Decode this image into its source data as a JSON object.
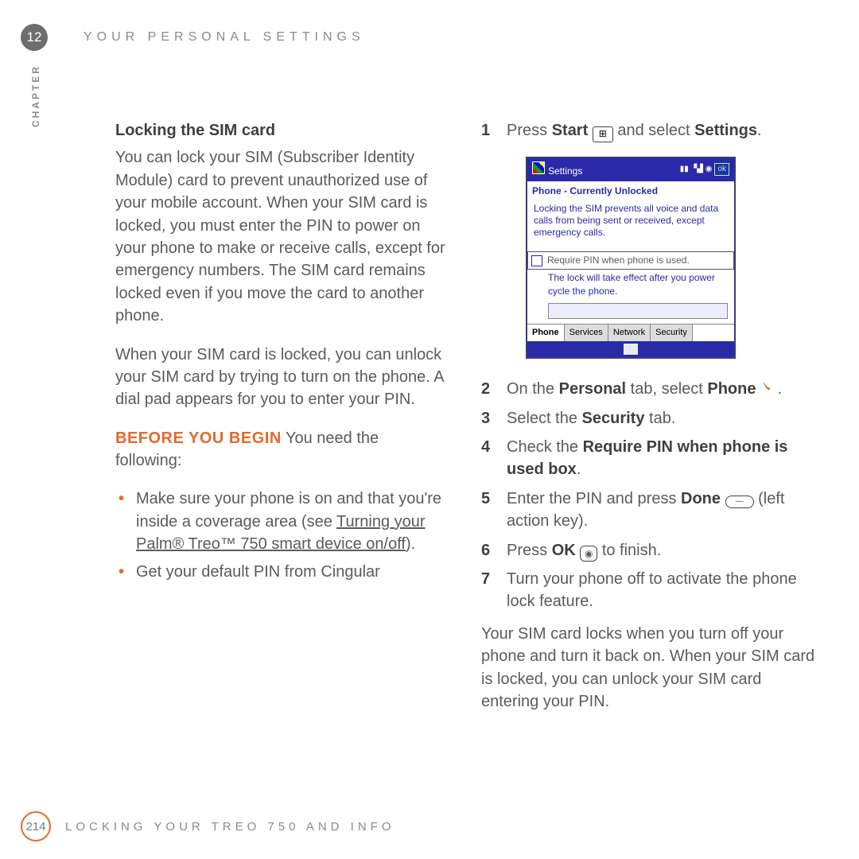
{
  "chapter_badge": "12",
  "chapter_label": "CHAPTER",
  "top_header": "YOUR PERSONAL SETTINGS",
  "left": {
    "heading": "Locking the SIM card",
    "p1": "You can lock your SIM (Subscriber Identity Module) card to prevent unauthorized use of your mobile account. When your SIM card is locked, you must enter the PIN to power on your phone to make or receive calls, except for emergency numbers. The SIM card remains locked even if you move the card to another phone.",
    "p2": "When your SIM card is locked, you can unlock your SIM card by trying to turn on the phone. A dial pad appears for you to enter your PIN.",
    "before_label": "BEFORE YOU BEGIN",
    "before_text": "You need the following:",
    "bullet1a": "Make sure your phone is on and that you're inside a coverage area (see ",
    "bullet1link": "Turning your Palm® Treo™ 750 smart device on/off",
    "bullet1b": ").",
    "bullet2": "Get your default PIN from Cingular"
  },
  "right": {
    "step1a": "Press ",
    "step1b": "Start",
    "step1c": " and select ",
    "step1d": "Settings",
    "step1e": ".",
    "step2a": "On the ",
    "step2b": "Personal",
    "step2c": " tab, select ",
    "step2d": "Phone",
    "step2e": " .",
    "step3a": "Select the ",
    "step3b": "Security",
    "step3c": " tab.",
    "step4a": "Check the ",
    "step4b": "Require PIN when phone is used box",
    "step4c": ".",
    "step5a": "Enter the PIN and press ",
    "step5b": "Done",
    "step5c": " (left action key).",
    "step6a": "Press ",
    "step6b": "OK",
    "step6c": " to finish.",
    "step7": "Turn your phone off to activate the phone lock feature.",
    "closing": "Your SIM card locks when you turn off your phone and turn it back on. When your SIM card is locked, you can unlock your SIM card entering your PIN."
  },
  "device": {
    "title": "Settings",
    "subhead": "Phone - Currently Unlocked",
    "body": "Locking the SIM prevents all voice and data calls from being sent or received, except emergency calls.",
    "check_label": "Require PIN when phone is used.",
    "note": "The lock will take effect after you power cycle the phone.",
    "tab1": "Phone",
    "tab2": "Services",
    "tab3": "Network",
    "tab4": "Security"
  },
  "footer": {
    "page": "214",
    "text": "LOCKING YOUR TREO 750 AND INFO"
  }
}
